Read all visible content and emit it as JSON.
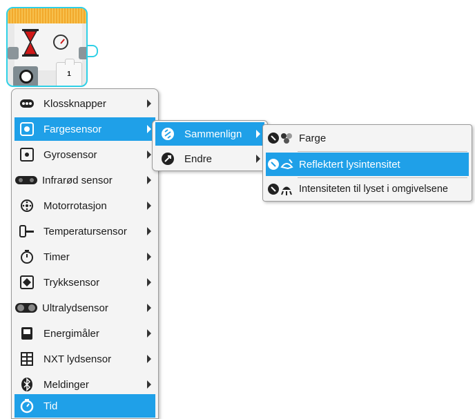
{
  "block": {
    "param_value": "1",
    "border_color": "#2fd0e6",
    "header_color": "#f2a92c"
  },
  "menu": {
    "items": [
      {
        "label": "Klossknapper",
        "icon": "brick-buttons-icon",
        "has_submenu": true
      },
      {
        "label": "Fargesensor",
        "icon": "color-sensor-icon",
        "has_submenu": true,
        "selected": true
      },
      {
        "label": "Gyrosensor",
        "icon": "gyro-sensor-icon",
        "has_submenu": true
      },
      {
        "label": "Infrarød sensor",
        "icon": "infrared-sensor-icon",
        "has_submenu": true
      },
      {
        "label": "Motorrotasjon",
        "icon": "motor-rotation-icon",
        "has_submenu": true
      },
      {
        "label": "Temperatursensor",
        "icon": "temperature-sensor-icon",
        "has_submenu": true
      },
      {
        "label": "Timer",
        "icon": "timer-icon",
        "has_submenu": true
      },
      {
        "label": "Trykksensor",
        "icon": "touch-sensor-icon",
        "has_submenu": true
      },
      {
        "label": "Ultralydsensor",
        "icon": "ultrasonic-sensor-icon",
        "has_submenu": true
      },
      {
        "label": "Energimåler",
        "icon": "energy-meter-icon",
        "has_submenu": true
      },
      {
        "label": "NXT lydsensor",
        "icon": "nxt-sound-sensor-icon",
        "has_submenu": true
      },
      {
        "label": "Meldinger",
        "icon": "bluetooth-messaging-icon",
        "has_submenu": true
      },
      {
        "label": "Tid",
        "icon": "time-icon",
        "has_submenu": false,
        "selected": true
      }
    ]
  },
  "submenu": {
    "items": [
      {
        "label": "Sammenlign",
        "icon": "compare-icon",
        "has_submenu": true,
        "selected": true
      },
      {
        "label": "Endre",
        "icon": "change-icon",
        "has_submenu": true
      }
    ]
  },
  "submenu2": {
    "items": [
      {
        "label": "Farge",
        "icon": "color-mode-icon"
      },
      {
        "label": "Reflektert lysintensitet",
        "icon": "reflected-light-icon",
        "selected": true
      },
      {
        "label": "Intensiteten til lyset i omgivelsene",
        "icon": "ambient-light-icon"
      }
    ]
  },
  "colors": {
    "selection": "#1fa0e8",
    "menu_background": "#f4f4f4",
    "hourglass_red": "#d01818"
  }
}
